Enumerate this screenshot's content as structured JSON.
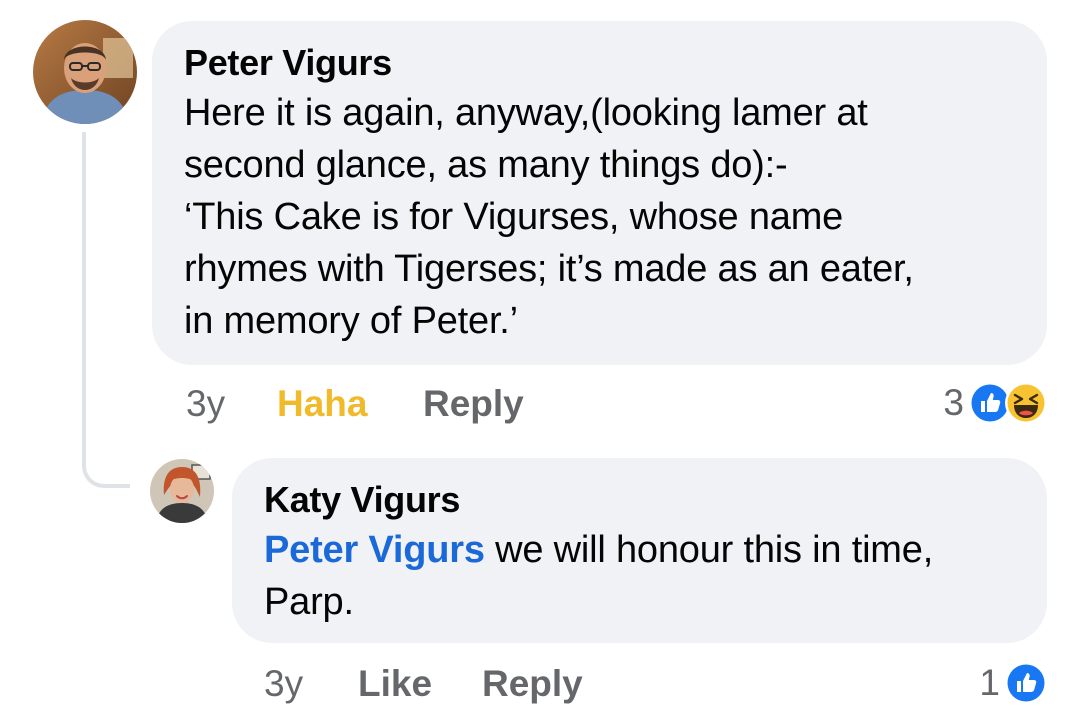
{
  "comments": [
    {
      "author": "Peter Vigurs",
      "lines": [
        "Here it is again, anyway,(looking lamer at",
        "second glance, as many things do):-",
        "‘This Cake is for Vigurses, whose name",
        "rhymes with Tigerses; it’s made as an eater,",
        "in memory of Peter.’"
      ],
      "time": "3y",
      "reaction_label": "Haha",
      "reply_label": "Reply",
      "reaction_count": "3",
      "reaction_icons": [
        "like-icon",
        "haha-icon"
      ]
    },
    {
      "author": "Katy Vigurs",
      "mention": "Peter Vigurs",
      "text_line1_rest": " we will honour this in time,",
      "text_line2": "Parp.",
      "time": "3y",
      "reaction_label": "Like",
      "reply_label": "Reply",
      "reaction_count": "1",
      "reaction_icons": [
        "like-icon"
      ]
    }
  ],
  "colors": {
    "bubble": "#f0f2f5",
    "secondary_text": "#65676b",
    "haha_active": "#f0ba2a",
    "mention": "#1b69d8",
    "like_blue": "#1877f2"
  }
}
